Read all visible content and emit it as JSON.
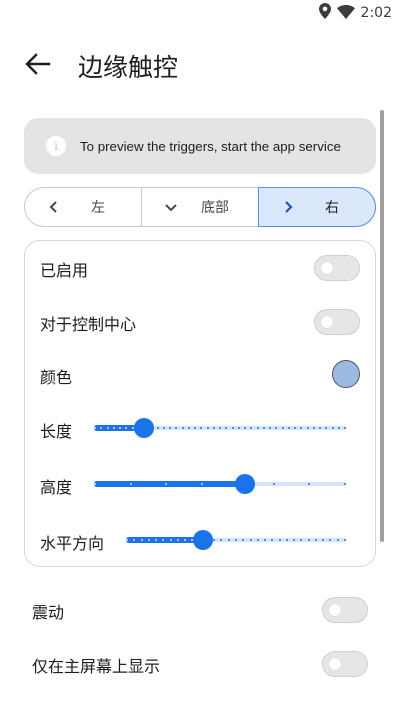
{
  "status_bar": {
    "time": "2:02",
    "icons": [
      "location-icon",
      "wifi-icon"
    ]
  },
  "header": {
    "title": "边缘触控",
    "back_icon": "arrow-left-icon"
  },
  "banner": {
    "icon": "info-icon",
    "text": "To preview the triggers, start the app service"
  },
  "edge_tabs": [
    {
      "label": "左",
      "icon": "chevron-left-icon",
      "selected": false
    },
    {
      "label": "底部",
      "icon": "chevron-down-icon",
      "selected": false
    },
    {
      "label": "右",
      "icon": "chevron-right-icon",
      "selected": true
    }
  ],
  "card": {
    "enabled": {
      "label": "已启用",
      "on": false
    },
    "control_center": {
      "label": "对于控制中心",
      "on": false
    },
    "color": {
      "label": "颜色",
      "value": "#9bbbe4"
    },
    "length": {
      "label": "长度",
      "value": 0.2,
      "steps": 40
    },
    "height": {
      "label": "高度",
      "value": 0.6,
      "steps": 7
    },
    "horizontal": {
      "label": "水平方向",
      "value": 0.35,
      "steps": 30
    }
  },
  "vibration": {
    "label": "震动",
    "on": false
  },
  "home_only": {
    "label": "仅在主屏幕上显示",
    "on": false
  },
  "colors": {
    "accent": "#1a73e8",
    "track_inactive": "#d5e3fc",
    "selected_tab_bg": "#dbe7fb",
    "selected_tab_border": "#5b8def",
    "banner_bg": "#e4e4e6"
  }
}
